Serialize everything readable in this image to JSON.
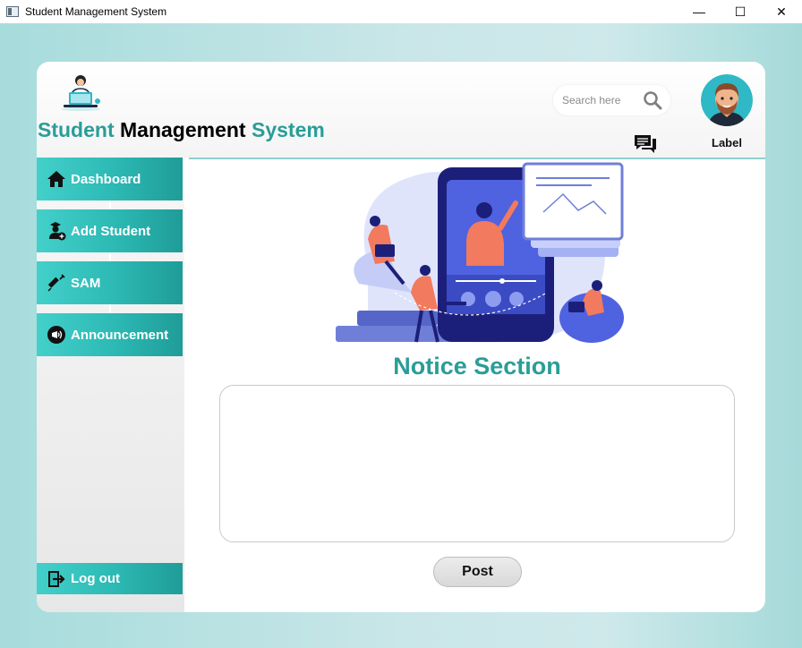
{
  "window": {
    "title": "Student Management System",
    "minimize": "—",
    "maximize": "☐",
    "close": "✕"
  },
  "header": {
    "brand_part1": "Student",
    "brand_part2": "Management",
    "brand_part3": "System",
    "search_placeholder": "Search here",
    "avatar_label": "Label"
  },
  "sidebar": {
    "items": [
      {
        "label": "Dashboard",
        "icon": "home-icon"
      },
      {
        "label": "Add Student",
        "icon": "add-student-icon"
      },
      {
        "label": "SAM",
        "icon": "syringe-icon"
      },
      {
        "label": "Announcement",
        "icon": "announcement-icon"
      }
    ],
    "logout": {
      "label": "Log out",
      "icon": "logout-icon"
    }
  },
  "main": {
    "notice_title": "Notice Section",
    "notice_value": "",
    "post_label": "Post"
  },
  "colors": {
    "accent": "#2a9d98",
    "nav_gradient_start": "#43d0cb",
    "nav_gradient_end": "#1f9c98"
  }
}
